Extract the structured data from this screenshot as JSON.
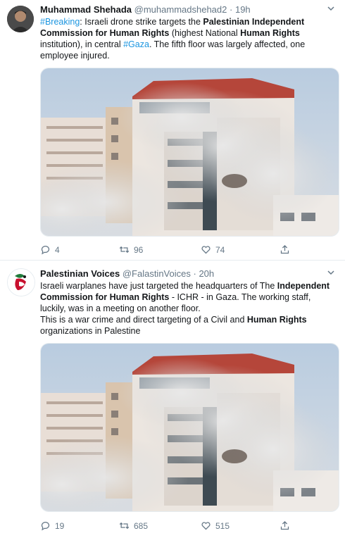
{
  "tweets": [
    {
      "author": {
        "name": "Muhammad Shehada",
        "handle": "@muhammadshehad2",
        "time": "19h",
        "avatar_icon": "user-photo"
      },
      "text": {
        "p1": "#Breaking",
        "p2": ": Israeli drone strike targets the ",
        "p3": "Palestinian Independent Commission for Human Rights",
        "p4": " (highest National ",
        "p5": "Human Rights",
        "p6": " institution), in central ",
        "p7": "#Gaza",
        "p8": ". The fifth floor was largely affected, one employee injured."
      },
      "stats": {
        "replies": "4",
        "retweets": "96",
        "likes": "74"
      }
    },
    {
      "author": {
        "name": "Palestinian Voices",
        "handle": "@FalastinVoices",
        "time": "20h",
        "avatar_icon": "dove-logo"
      },
      "text": {
        "p1": "Israeli warplanes have just targeted the headquarters of The ",
        "p2": "Independent Commission for Human Rights",
        "p3": " - ICHR - in Gaza. The working staff, luckily, was in a meeting on another floor.",
        "p4": "This is a war crime and direct targeting of a Civil and ",
        "p5": "Human Rights",
        "p6": " organizations in Palestine"
      },
      "stats": {
        "replies": "19",
        "retweets": "685",
        "likes": "515"
      }
    }
  ],
  "colors": {
    "link": "#1b95e0",
    "muted": "#657786",
    "text": "#14171a",
    "divider": "#e6ecf0"
  }
}
